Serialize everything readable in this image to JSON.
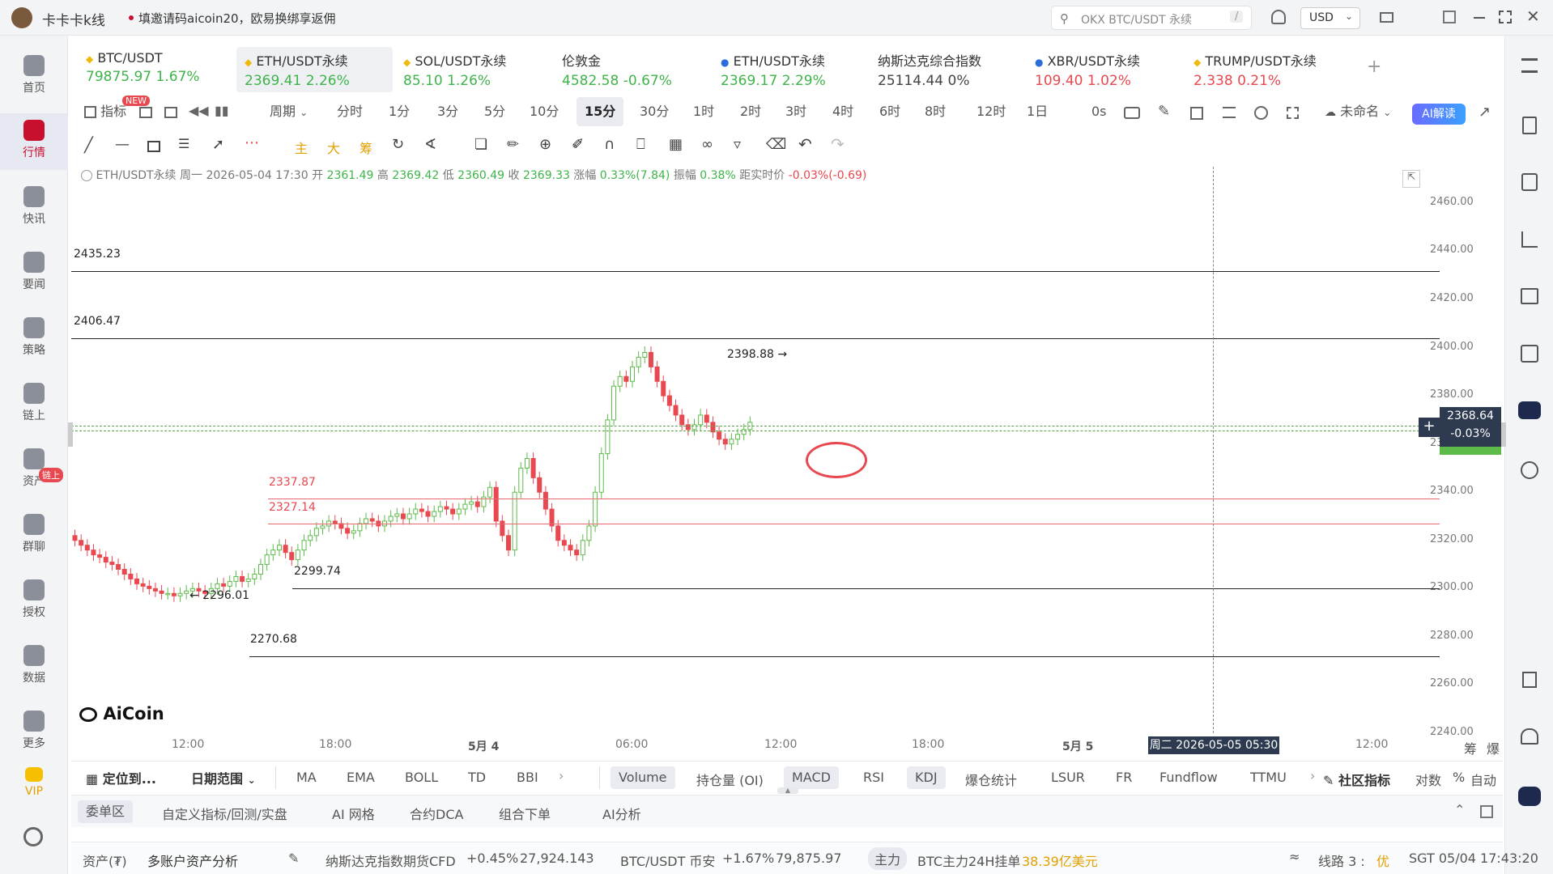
{
  "app": {
    "title": "卡卡卡k线",
    "notice": "填邀请码aicoin20，欧易换绑享返佣",
    "search_placeholder": "OKX BTC/USDT 永续",
    "search_key": "/",
    "currency": "USD"
  },
  "left_nav": [
    {
      "label": "首页",
      "active": false
    },
    {
      "label": "行情",
      "active": true
    },
    {
      "label": "快讯",
      "active": false
    },
    {
      "label": "要闻",
      "active": false
    },
    {
      "label": "策略",
      "active": false
    },
    {
      "label": "链上",
      "active": false
    },
    {
      "label": "资产",
      "active": false
    },
    {
      "label": "群聊",
      "active": false
    },
    {
      "label": "授权",
      "active": false
    },
    {
      "label": "数据",
      "active": false
    },
    {
      "label": "更多",
      "active": false
    },
    {
      "label": "VIP",
      "active": false
    }
  ],
  "chain_badge": "链上",
  "tickers": [
    {
      "name": "BTC/USDT",
      "price": "79875.97",
      "change": "1.67%",
      "dir": "up",
      "active": false
    },
    {
      "name": "ETH/USDT永续",
      "price": "2369.41",
      "change": "2.26%",
      "dir": "up",
      "active": true
    },
    {
      "name": "SOL/USDT永续",
      "price": "85.10",
      "change": "1.26%",
      "dir": "up",
      "active": false
    },
    {
      "name": "伦敦金",
      "price": "4582.58",
      "change": "-0.67%",
      "dir": "up",
      "active": false
    },
    {
      "name": "ETH/USDT永续",
      "price": "2369.17",
      "change": "2.29%",
      "dir": "up",
      "active": false
    },
    {
      "name": "纳斯达克综合指数",
      "price": "25114.44",
      "change": "0%",
      "dir": "flat",
      "active": false
    },
    {
      "name": "XBR/USDT永续",
      "price": "109.40",
      "change": "1.02%",
      "dir": "dn",
      "active": false
    },
    {
      "name": "TRUMP/USDT永续",
      "price": "2.338",
      "change": "0.21%",
      "dir": "dn",
      "active": false
    }
  ],
  "toolbar": {
    "indicator": "指标",
    "new_badge": "NEW",
    "period": "周期",
    "intervals": [
      "分时",
      "1分",
      "3分",
      "5分",
      "10分",
      "15分",
      "30分",
      "1时",
      "2时",
      "3时",
      "4时",
      "6时",
      "8时",
      "12时",
      "1日"
    ],
    "selected_interval": "15分",
    "countdown": "0s",
    "unnamed": "未命名",
    "ai_button": "AI解读"
  },
  "drawbar": {
    "main": "主",
    "big": "大",
    "chip": "筹"
  },
  "ohlc": {
    "symbol": "ETH/USDT永续",
    "weekday": "周一",
    "datetime": "2026-05-04 17:30",
    "open_label": "开",
    "open": "2361.49",
    "high_label": "高",
    "high": "2369.42",
    "low_label": "低",
    "low": "2360.49",
    "close_label": "收",
    "close": "2369.33",
    "chg_label": "涨幅",
    "chg": "0.33%(7.84)",
    "amp_label": "振幅",
    "amp": "0.38%",
    "dist_label": "距实时价",
    "dist": "-0.03%(-0.69)"
  },
  "levels": {
    "black": [
      "2435.23",
      "2406.47",
      "2299.74",
      "2270.68"
    ],
    "red": [
      "2337.87",
      "2327.14"
    ],
    "peak": "2398.88 →",
    "trough": "← 2296.01"
  },
  "price_tag": {
    "price": "2368.64",
    "pct": "-0.03%"
  },
  "chart_data": {
    "type": "candlestick",
    "ylim": [
      2240,
      2465
    ],
    "yticks": [
      "2460.00",
      "2440.00",
      "2420.00",
      "2400.00",
      "2380.00",
      "2360.00",
      "2340.00",
      "2320.00",
      "2300.00",
      "2280.00",
      "2260.00",
      "2240.00"
    ],
    "xticks": [
      "12:00",
      "18:00",
      "5月 4",
      "06:00",
      "12:00",
      "18:00",
      "5月 5",
      "12:00"
    ],
    "crosshair_label": "周二 2026-05-05 05:30",
    "series": [
      {
        "name": "ETH/USDT永续 15m",
        "close": [
          2320,
          2318,
          2316,
          2314,
          2313,
          2311,
          2310,
          2308,
          2306,
          2304,
          2302,
          2301,
          2300,
          2299,
          2298,
          2298,
          2297,
          2298,
          2299,
          2300,
          2299,
          2298,
          2300,
          2302,
          2301,
          2303,
          2305,
          2303,
          2304,
          2306,
          2310,
          2314,
          2316,
          2318,
          2315,
          2312,
          2316,
          2320,
          2322,
          2325,
          2326,
          2328,
          2327,
          2325,
          2323,
          2324,
          2327,
          2329,
          2328,
          2326,
          2328,
          2330,
          2331,
          2329,
          2331,
          2333,
          2332,
          2330,
          2332,
          2334,
          2333,
          2331,
          2333,
          2335,
          2336,
          2334,
          2338,
          2342,
          2328,
          2322,
          2316,
          2340,
          2350,
          2354,
          2346,
          2340,
          2333,
          2326,
          2320,
          2318,
          2316,
          2314,
          2320,
          2326,
          2340,
          2356,
          2370,
          2384,
          2388,
          2386,
          2392,
          2396,
          2398,
          2392,
          2386,
          2380,
          2376,
          2372,
          2368,
          2366,
          2368,
          2372,
          2369,
          2365,
          2362,
          2360,
          2362,
          2364,
          2366,
          2369
        ]
      }
    ]
  },
  "logo": "AiCoin",
  "chart_right_tools": [
    "筹",
    "爆"
  ],
  "indicator_bar": {
    "locate": "定位到...",
    "date_range": "日期范围",
    "main": [
      "MA",
      "EMA",
      "BOLL",
      "TD",
      "BBI"
    ],
    "sub": [
      "Volume",
      "持仓量 (OI)",
      "MACD",
      "RSI",
      "KDJ",
      "爆仓统计",
      "LSUR",
      "FR",
      "Fundflow",
      "TTMU"
    ],
    "community": "社区指标",
    "log": "对数",
    "percent": "%",
    "auto": "自动"
  },
  "bottom_tabs": [
    "委单区",
    "自定义指标/回测/实盘",
    "AI 网格",
    "合约DCA",
    "组合下单",
    "AI分析"
  ],
  "status_bar": {
    "assets": "资产(₮)",
    "multi": "多账户资产分析",
    "item1_name": "纳斯达克指数期货CFD",
    "item1_change": "+0.45%",
    "item1_price": "27,924.143",
    "item2_name": "BTC/USDT 币安",
    "item2_change": "+1.67%",
    "item2_price": "79,875.97",
    "main_badge": "主力",
    "main_text": "BTC主力24H挂单",
    "main_value": "38.39亿美元",
    "route": "线路 3 :",
    "route_quality": "优",
    "time": "SGT 05/04 17:43:20"
  }
}
